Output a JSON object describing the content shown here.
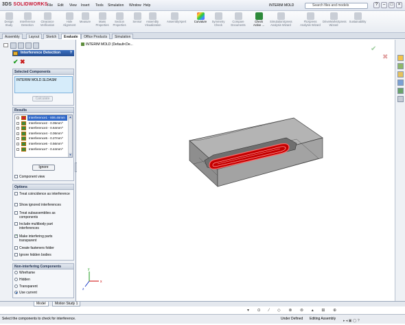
{
  "app": {
    "logo": "SOLIDWORKS",
    "logo_prefix": "3DS ",
    "document_title": "INTERIM MOLD"
  },
  "menu": [
    "File",
    "Edit",
    "View",
    "Insert",
    "Tools",
    "Simulation",
    "Window",
    "Help"
  ],
  "search": {
    "placeholder": "Search files and models"
  },
  "toolbar": [
    {
      "label": "Design Study",
      "enabled": false
    },
    {
      "label": "Interference Detection",
      "enabled": false
    },
    {
      "label": "Clearance Verification",
      "enabled": false
    },
    {
      "label": "Hole Alignment",
      "enabled": false
    },
    {
      "label": "Measure",
      "enabled": false
    },
    {
      "label": "Mass Properties",
      "enabled": false
    },
    {
      "label": "Section Properties",
      "enabled": false
    },
    {
      "label": "Sensor",
      "enabled": false
    },
    {
      "label": "Assembly Visualization",
      "enabled": false
    },
    {
      "label": "AssemblyXpert",
      "enabled": false
    },
    {
      "label": "Curvature",
      "enabled": true
    },
    {
      "label": "Symmetry Check",
      "enabled": false
    },
    {
      "label": "Compare Documents",
      "enabled": false
    },
    {
      "label": "Check Active ...",
      "enabled": true
    },
    {
      "label": "SimulationXpress Analysis Wizard",
      "enabled": false
    },
    {
      "label": "FloXpress Analysis Wizard",
      "enabled": false
    },
    {
      "label": "DriveWorksXpress Wizard",
      "enabled": false
    },
    {
      "label": "Sustainability",
      "enabled": false
    }
  ],
  "tabs": [
    "Assembly",
    "Layout",
    "Sketch",
    "Evaluate",
    "Office Products",
    "Simulation"
  ],
  "active_tab": "Evaluate",
  "property_manager": {
    "title": "Interference Detection",
    "help": "?",
    "selected_components": {
      "title": "Selected Components",
      "items": [
        "INTERIM MOLD.SLDASM"
      ],
      "calculate_label": "Calculate"
    },
    "results": {
      "title": "Results",
      "items": [
        "Interference1 - 806.46mm",
        "Interference2 - 0.05mm^",
        "Interference3 - 0.64mm^",
        "Interference4 - 0.06mm^",
        "Interference5 - 0.27mm^",
        "Interference6 - 0.56mm^",
        "Interference7 - 0.44mm^"
      ],
      "ignore_label": "Ignore",
      "component_view_label": "Component view"
    },
    "options": {
      "title": "Options",
      "items": [
        {
          "label": "Treat coincidence as interference",
          "checked": false
        },
        {
          "label": "Show ignored interferences",
          "checked": false
        },
        {
          "label": "Treat subassemblies as components",
          "checked": false
        },
        {
          "label": "Include multibody part interferences",
          "checked": false
        },
        {
          "label": "Make interfering parts transparent",
          "checked": true
        },
        {
          "label": "Create fasteners folder",
          "checked": false
        },
        {
          "label": "Ignore hidden bodies",
          "checked": false
        }
      ]
    },
    "non_interfering": {
      "title": "Non-interfering Components",
      "items": [
        {
          "label": "Wireframe",
          "selected": false
        },
        {
          "label": "Hidden",
          "selected": false
        },
        {
          "label": "Transparent",
          "selected": false
        },
        {
          "label": "Use current",
          "selected": true
        }
      ]
    }
  },
  "viewport": {
    "tree_item": "INTERIM MOLD (Default<De..."
  },
  "bottom_tabs": [
    "Model",
    "Motion Study 1"
  ],
  "status": {
    "hint": "Select the components to check for interference.",
    "defined": "Under Defined",
    "mode": "Editing Assembly"
  },
  "colors": {
    "accent": "#3068c8",
    "interference": "#d40000",
    "logo": "#c8102e"
  }
}
